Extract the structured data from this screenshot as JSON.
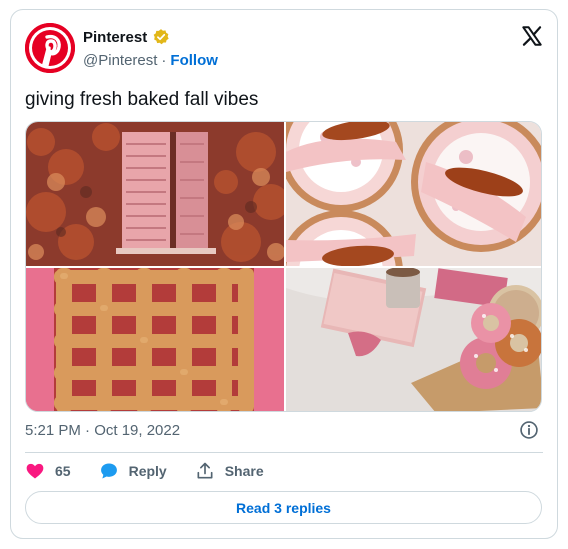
{
  "author": {
    "name": "Pinterest",
    "handle": "@Pinterest",
    "separator": "·",
    "follow_label": "Follow",
    "avatar_icon": "pinterest-logo-icon",
    "badge_icon": "verified-badge-icon",
    "brand_color": "#e60023",
    "badge_color": "#e2b719"
  },
  "platform_icon": "x-logo-icon",
  "tweet": {
    "text": "giving fresh baked fall vibes",
    "timestamp": "5:21 PM · Oct 19, 2022"
  },
  "media": {
    "images": [
      {
        "subject": "window-with-pink-shutters-and-ivy"
      },
      {
        "subject": "plates-with-leaf-name-cards"
      },
      {
        "subject": "lattice-pie"
      },
      {
        "subject": "pink-donuts-and-coffee"
      }
    ]
  },
  "actions": {
    "likes_count": "65",
    "reply_label": "Reply",
    "share_label": "Share",
    "like_color": "#f91880",
    "reply_color": "#1d9bf0"
  },
  "replies_button": {
    "label": "Read 3 replies"
  }
}
